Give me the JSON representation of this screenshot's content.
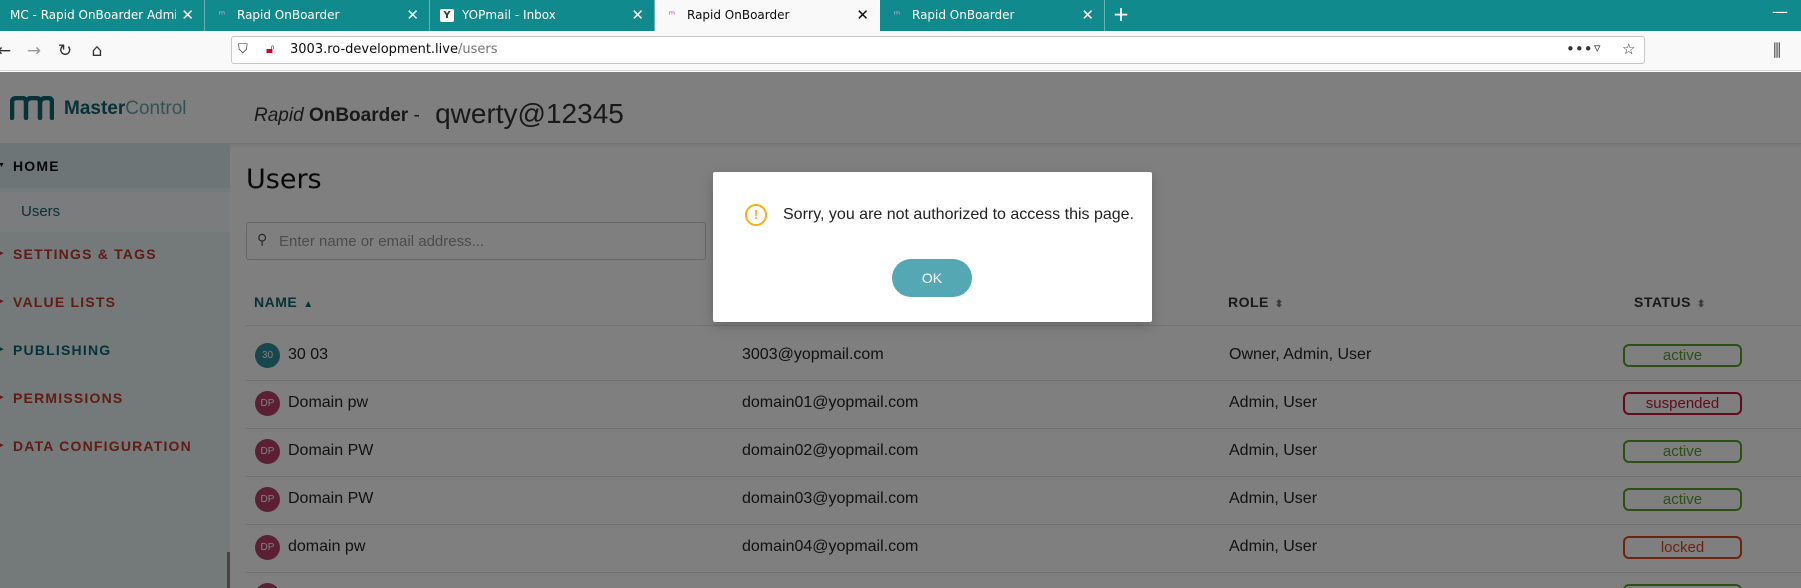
{
  "browser": {
    "tabs": [
      {
        "title": "MC - Rapid OnBoarder Admin",
        "active": false
      },
      {
        "title": "Rapid OnBoarder",
        "active": false
      },
      {
        "title": "YOPmail - Inbox",
        "active": false
      },
      {
        "title": "Rapid OnBoarder",
        "active": true
      },
      {
        "title": "Rapid OnBoarder",
        "active": false
      }
    ],
    "url_host": "3003.ro-development.live",
    "url_path": "/users"
  },
  "app": {
    "logo_text_1": "Master",
    "logo_text_2": "Control",
    "brand_rapid": "Rapid",
    "brand_onboarder": "OnBoarder",
    "brand_sep": "-",
    "brand_user": "qwerty@12345"
  },
  "sidebar": {
    "home": "HOME",
    "users": "Users",
    "items": [
      {
        "label": "SETTINGS & TAGS"
      },
      {
        "label": "VALUE LISTS"
      },
      {
        "label": "PUBLISHING"
      },
      {
        "label": "PERMISSIONS"
      },
      {
        "label": "DATA CONFIGURATION"
      }
    ]
  },
  "main": {
    "title": "Users",
    "search_placeholder": "Enter name or email address...",
    "columns": {
      "name": "NAME",
      "role": "ROLE",
      "status": "STATUS"
    },
    "rows": [
      {
        "initials": "30",
        "name": "30 03",
        "email": "3003@yopmail.com",
        "role": "Owner, Admin, User",
        "status": "active"
      },
      {
        "initials": "DP",
        "name": "Domain pw",
        "email": "domain01@yopmail.com",
        "role": "Admin, User",
        "status": "suspended"
      },
      {
        "initials": "DP",
        "name": "Domain PW",
        "email": "domain02@yopmail.com",
        "role": "Admin, User",
        "status": "active"
      },
      {
        "initials": "DP",
        "name": "Domain PW",
        "email": "domain03@yopmail.com",
        "role": "Admin, User",
        "status": "active"
      },
      {
        "initials": "DP",
        "name": "domain pw",
        "email": "domain04@yopmail.com",
        "role": "Admin, User",
        "status": "locked"
      }
    ]
  },
  "modal": {
    "message": "Sorry, you are not authorized to access this page.",
    "ok_label": "OK"
  },
  "colors": {
    "tab_bar": "#118a8e",
    "brand_teal": "#0e6470",
    "avatar_teal": "#2e8f9b",
    "avatar_pink": "#b8416a",
    "status_active": "#5aa02c",
    "status_suspended": "#c8143c",
    "status_locked": "#d9491e",
    "warning": "#faad14",
    "ok_button": "#54a8b3"
  }
}
